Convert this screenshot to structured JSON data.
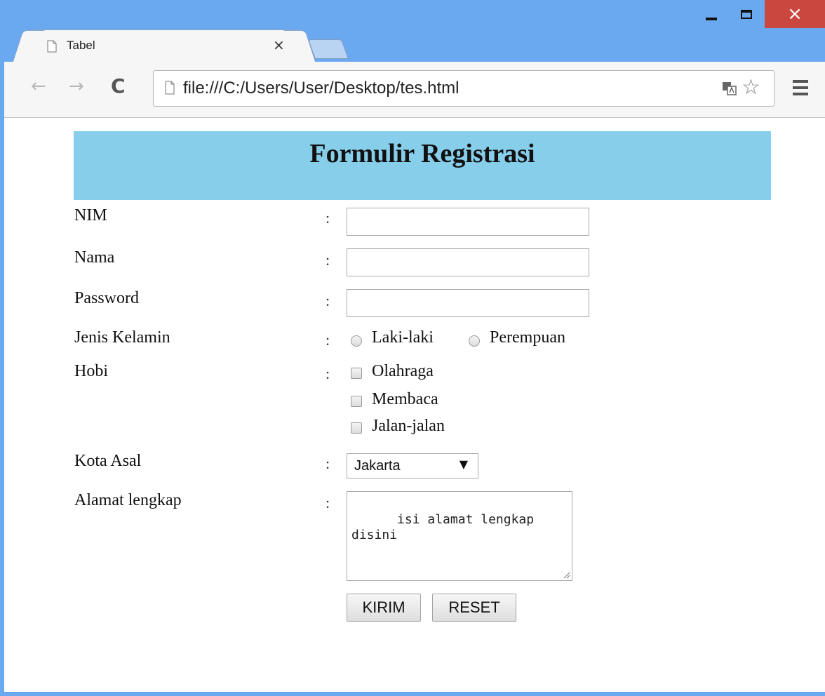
{
  "browser": {
    "tab_title": "Tabel",
    "tab_close": "×",
    "url": "file:///C:/Users/User/Desktop/tes.html",
    "window_close": "×"
  },
  "page": {
    "title": "Formulir Registrasi",
    "header_bg": "#87ceeb",
    "colon": ":",
    "fields": {
      "nim": {
        "label": "NIM",
        "value": ""
      },
      "nama": {
        "label": "Nama",
        "value": ""
      },
      "password": {
        "label": "Password",
        "value": ""
      },
      "jenis_kelamin": {
        "label": "Jenis Kelamin",
        "options": [
          "Laki-laki",
          "Perempuan"
        ]
      },
      "hobi": {
        "label": "Hobi",
        "options": [
          "Olahraga",
          "Membaca",
          "Jalan-jalan"
        ]
      },
      "kota_asal": {
        "label": "Kota Asal",
        "selected": "Jakarta"
      },
      "alamat": {
        "label": "Alamat lengkap",
        "value": "isi alamat lengkap disini"
      }
    },
    "buttons": {
      "submit": "KIRIM",
      "reset": "RESET"
    }
  }
}
